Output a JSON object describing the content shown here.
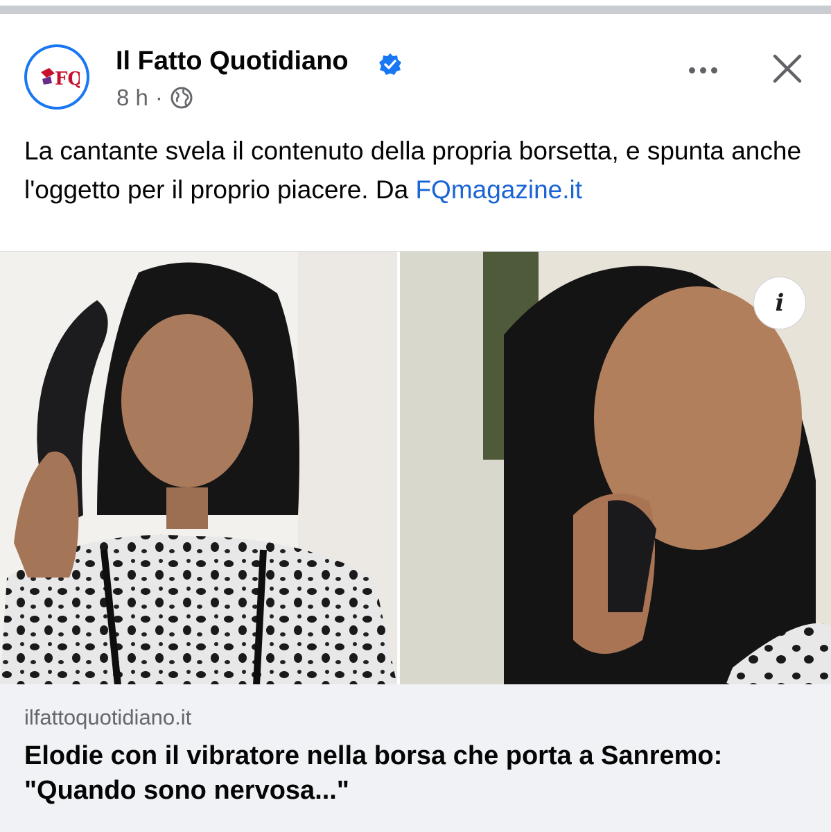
{
  "post": {
    "page_name": "Il Fatto Quotidiano",
    "logo_text": "FQ",
    "time": "8 h",
    "separator": "·",
    "caption_text": "La cantante svela il contenuto della propria borsetta, e spunta anche l'oggetto per il proprio piacere. Da ",
    "caption_link": "FQmagazine.it",
    "icons": {
      "verified": "verified-badge-icon",
      "audience": "globe-icon",
      "more": "more-options-icon",
      "close": "close-icon",
      "info": "info-icon"
    },
    "info_label": "i"
  },
  "link_preview": {
    "domain": "ilfattoquotidiano.it",
    "headline": "Elodie con il vibratore nella borsa che porta a Sanremo: \"Quando sono nervosa...\""
  },
  "colors": {
    "brand_blue": "#1877f2",
    "link_blue": "#1b64d6",
    "meta_gray": "#65676b",
    "preview_bg": "#f0f2f5"
  }
}
